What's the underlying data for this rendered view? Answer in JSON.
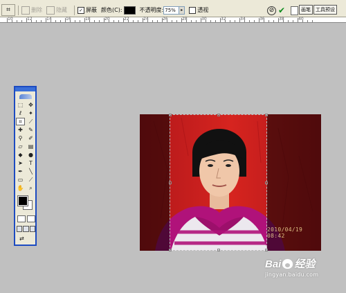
{
  "optionsbar": {
    "delete_crop_label": "删除",
    "hide_label": "隐藏",
    "shield_checked": true,
    "shield_label": "屏蔽",
    "color_label": "颜色(C):",
    "shield_color": "#000000",
    "opacity_label": "不透明度:",
    "opacity_value": "75%",
    "perspective_checked": false,
    "perspective_label": "透视",
    "tabs": [
      "画笔",
      "工具预设"
    ]
  },
  "ruler": {
    "labels": [
      "10",
      "12",
      "14",
      "16",
      "18",
      "20",
      "22",
      "24",
      "26",
      "28",
      "30",
      "32",
      "34",
      "36",
      "38",
      "40"
    ]
  },
  "toolbox": {
    "tools": [
      {
        "icon": "marquee-icon",
        "glyph": "⬚"
      },
      {
        "icon": "move-icon",
        "glyph": "✥"
      },
      {
        "icon": "lasso-icon",
        "glyph": "ℓ"
      },
      {
        "icon": "magic-wand-icon",
        "glyph": "✦"
      },
      {
        "icon": "crop-icon",
        "glyph": "⌗",
        "active": true
      },
      {
        "icon": "slice-icon",
        "glyph": "⟋"
      },
      {
        "icon": "healing-brush-icon",
        "glyph": "✚"
      },
      {
        "icon": "brush-icon",
        "glyph": "✎"
      },
      {
        "icon": "clone-stamp-icon",
        "glyph": "⚲"
      },
      {
        "icon": "history-brush-icon",
        "glyph": "✐"
      },
      {
        "icon": "eraser-icon",
        "glyph": "▱"
      },
      {
        "icon": "gradient-icon",
        "glyph": "▤"
      },
      {
        "icon": "blur-icon",
        "glyph": "◆"
      },
      {
        "icon": "dodge-icon",
        "glyph": "●"
      },
      {
        "icon": "path-select-icon",
        "glyph": "➤"
      },
      {
        "icon": "type-icon",
        "glyph": "T"
      },
      {
        "icon": "pen-icon",
        "glyph": "✒"
      },
      {
        "icon": "shape-icon",
        "glyph": "╲"
      },
      {
        "icon": "notes-icon",
        "glyph": "▭"
      },
      {
        "icon": "eyedropper-icon",
        "glyph": "⟋"
      },
      {
        "icon": "hand-icon",
        "glyph": "✋"
      },
      {
        "icon": "zoom-icon",
        "glyph": "⌕"
      }
    ]
  },
  "canvas": {
    "date_stamp": "2010/04/19 08:42"
  },
  "watermark": {
    "logo_left": "Bai",
    "logo_right": "经验",
    "url": "jingyan.baidu.com"
  },
  "colors": {
    "panel": "#ece9d8",
    "workspace": "#c0c0c0",
    "toolbox_border": "#1c4bc1",
    "backdrop_red": "#c8151b",
    "shirt_magenta": "#b0127a"
  }
}
